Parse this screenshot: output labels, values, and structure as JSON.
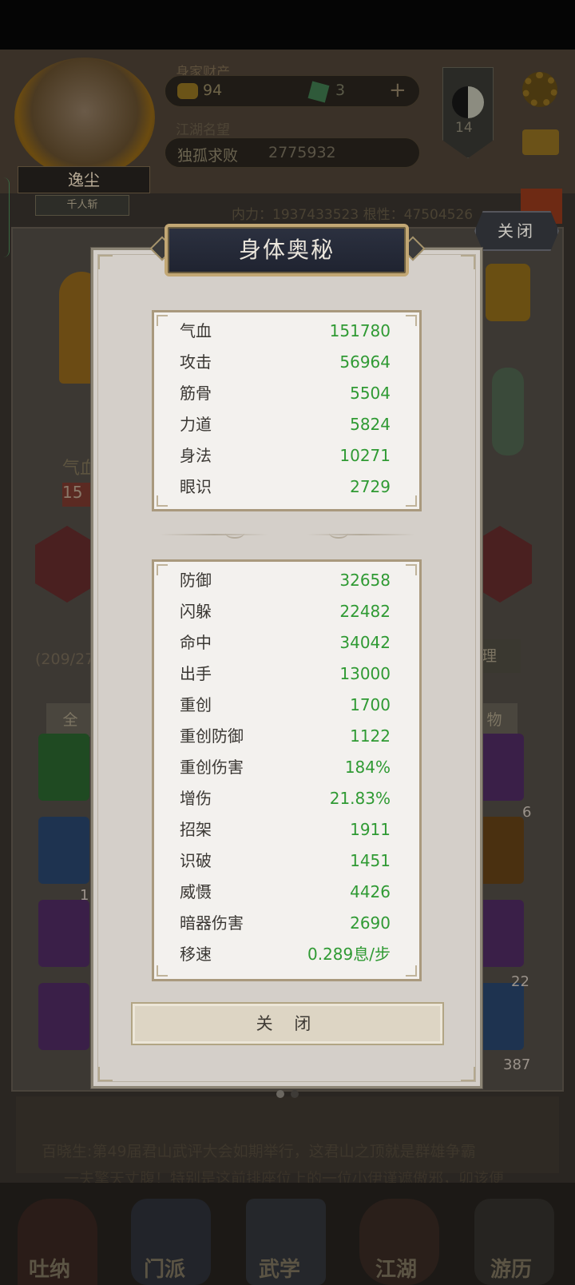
{
  "background": {
    "assets_label": "身家财产",
    "gold_value": "94",
    "jade_value": "3",
    "fame_label": "江湖名望",
    "fame_title": "独孤求败",
    "fame_value": "2775932",
    "yinyang_level": "14",
    "player_name": "逸尘",
    "player_title": "千人斩",
    "power_line": "内力：1937433523    根性：47504526",
    "close_button": "关闭",
    "stat_fragment": "气血",
    "stat_fragment_value": "15",
    "bag_count": "(209/27",
    "sort_button": "整理",
    "filter_all": "全",
    "filter_item": "物",
    "item_counts": [
      "6",
      "1",
      "22",
      "387"
    ],
    "news_line1": "百晓生:第49届君山武评大会如期举行，这君山之顶就是群雄争霸",
    "news_line2": "一夫擎天丈腹！特别是这前排座位上的一位小伊谨遮傲邪，卯该便",
    "nav": [
      "吐纳",
      "门派",
      "武学",
      "江湖",
      "游历"
    ]
  },
  "dialog": {
    "title": "身体奥秘",
    "close_button": "关 闭",
    "primary_stats": [
      {
        "name": "气血",
        "value": "151780"
      },
      {
        "name": "攻击",
        "value": "56964"
      },
      {
        "name": "筋骨",
        "value": "5504"
      },
      {
        "name": "力道",
        "value": "5824"
      },
      {
        "name": "身法",
        "value": "10271"
      },
      {
        "name": "眼识",
        "value": "2729"
      }
    ],
    "secondary_stats": [
      {
        "name": "防御",
        "value": "32658"
      },
      {
        "name": "闪躲",
        "value": "22482"
      },
      {
        "name": "命中",
        "value": "34042"
      },
      {
        "name": "出手",
        "value": "13000"
      },
      {
        "name": "重创",
        "value": "1700"
      },
      {
        "name": "重创防御",
        "value": "1122"
      },
      {
        "name": "重创伤害",
        "value": "184%"
      },
      {
        "name": "增伤",
        "value": "21.83%"
      },
      {
        "name": "招架",
        "value": "1911"
      },
      {
        "name": "识破",
        "value": "1451"
      },
      {
        "name": "威慑",
        "value": "4426"
      },
      {
        "name": "暗器伤害",
        "value": "2690"
      },
      {
        "name": "移速",
        "value": "0.289息/步"
      }
    ]
  },
  "colors": {
    "stat_value": "#2f9a33",
    "stat_name": "#3a3733",
    "title_plate": "#2c3140",
    "title_border": "#c2a774"
  }
}
